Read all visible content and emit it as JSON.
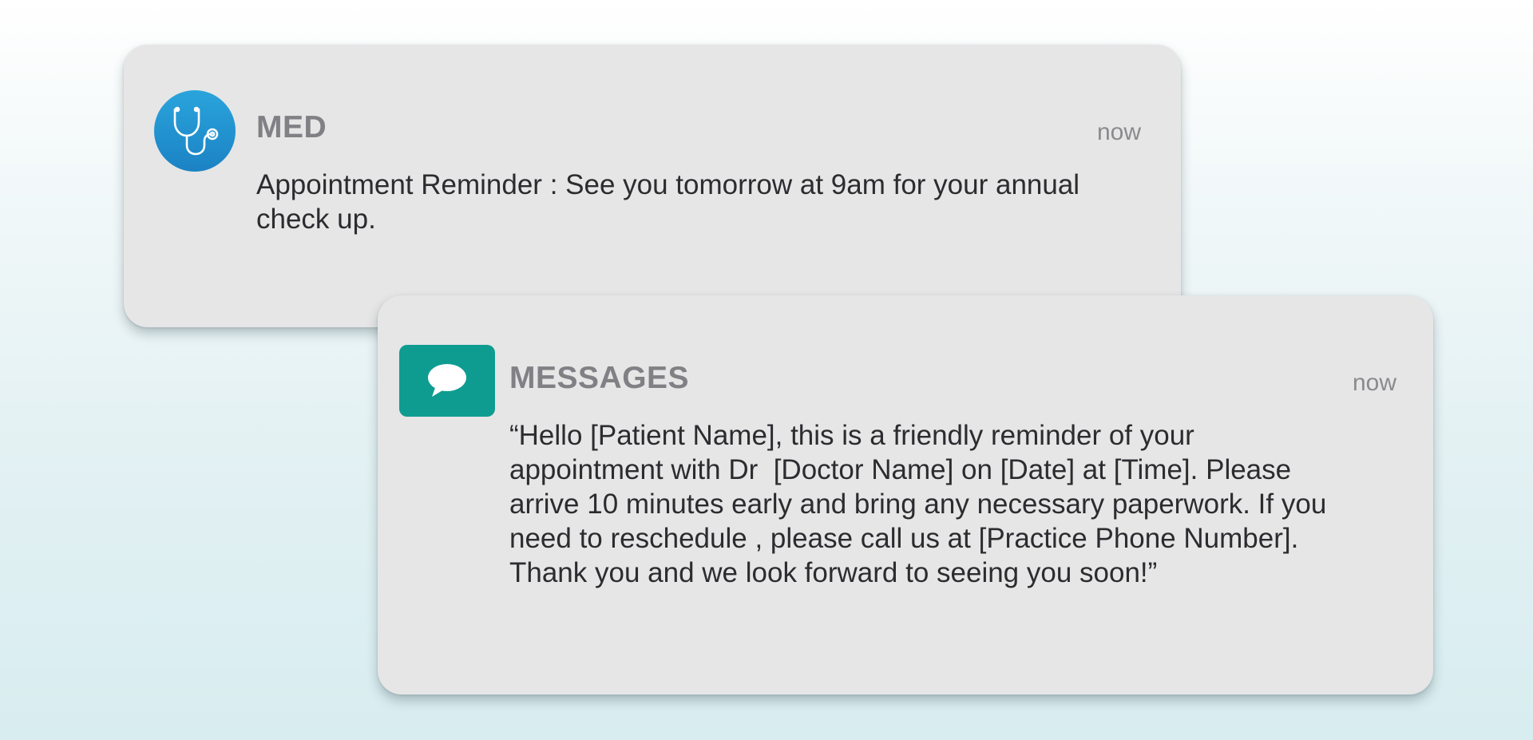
{
  "notifications": [
    {
      "app": "MED",
      "icon": "stethoscope-icon",
      "icon_color": "#1b8fcf",
      "time": "now",
      "message": "Appointment Reminder : See you tomorrow at 9am for your annual check up."
    },
    {
      "app": "MESSAGES",
      "icon": "chat-bubble-icon",
      "icon_color": "#0e9c91",
      "time": "now",
      "message": "“Hello [Patient Name], this is a friendly reminder of your appointment with Dr  [Doctor Name] on [Date] at [Time]. Please arrive 10 minutes early and bring any necessary paperwork. If you need to reschedule , please call us at [Practice Phone Number]. Thank you and we look forward to seeing you soon!”"
    }
  ]
}
